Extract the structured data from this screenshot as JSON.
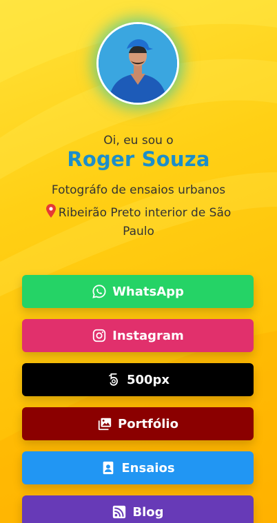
{
  "profile": {
    "greeting": "Oi, eu sou o",
    "name": "Roger Souza",
    "tagline": "Fotográfo de ensaios urbanos",
    "location": "Ribeirão Preto interior de São Paulo"
  },
  "links": [
    {
      "label": "WhatsApp",
      "icon": "whatsapp-icon",
      "color": "#25d366"
    },
    {
      "label": "Instagram",
      "icon": "instagram-icon",
      "color": "#e1306c"
    },
    {
      "label": "500px",
      "icon": "500px-icon",
      "color": "#000000"
    },
    {
      "label": "Portfólio",
      "icon": "images-icon",
      "color": "#8b0000"
    },
    {
      "label": "Ensaios",
      "icon": "portrait-icon",
      "color": "#2196f3"
    },
    {
      "label": "Blog",
      "icon": "rss-icon",
      "color": "#673ab7"
    }
  ],
  "colors": {
    "background": "#ffc400",
    "name": "#1c8ec9",
    "text": "#333333"
  }
}
